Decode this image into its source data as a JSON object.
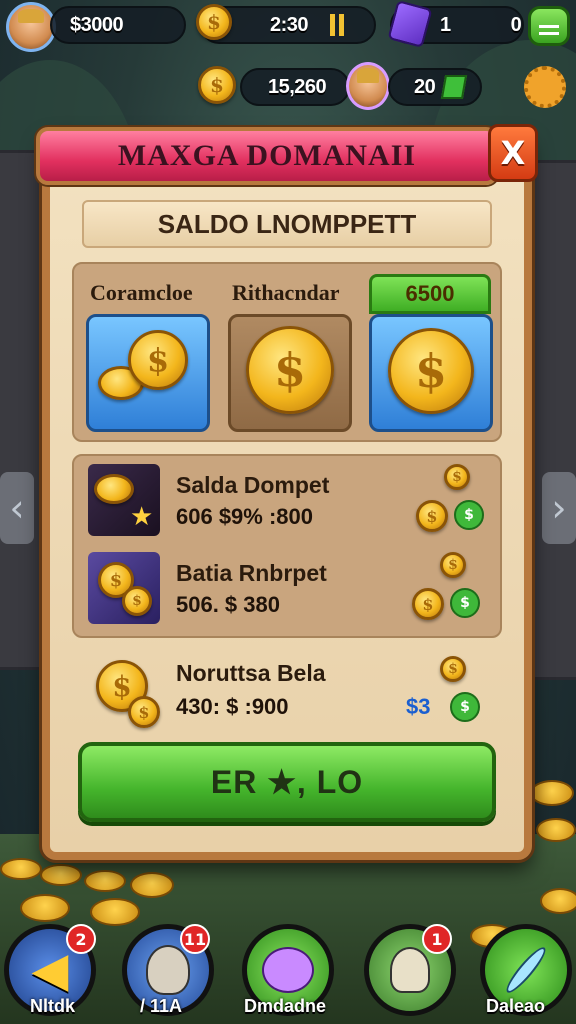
{
  "hud": {
    "balance": "$3000",
    "timer": "2:30",
    "item_count": "1",
    "zero": "0",
    "gold": "15,260",
    "level": "20"
  },
  "dialog": {
    "title": "MAXGA DOMANAII",
    "close": "X",
    "subtitle": "SALDO LNOMPPETT",
    "options": {
      "first_label": "Coramcloe",
      "second_label": "Rithacndar",
      "third_label": "6500"
    },
    "rows": [
      {
        "title": "Salda Dompet",
        "value": "606 $9% :800"
      },
      {
        "title": "Batia Rnbrpet",
        "value": "506. $ 380"
      },
      {
        "title": "Noruttsa Bela",
        "value": "430: $ :900"
      }
    ],
    "row_badge": "$3",
    "confirm_label": "ER ★, LO"
  },
  "nav": [
    {
      "label": "Nltdk",
      "badge": "2"
    },
    {
      "label": "/ 11A",
      "badge": "11"
    },
    {
      "label": "Dmdadne",
      "badge": ""
    },
    {
      "label": "",
      "badge": "1"
    },
    {
      "label": "Daleao",
      "badge": ""
    }
  ],
  "colors": {
    "title_bar": "#e2305f",
    "confirm_button": "#45b52c",
    "panel": "#f3e2c1",
    "frame": "#b8793e"
  }
}
